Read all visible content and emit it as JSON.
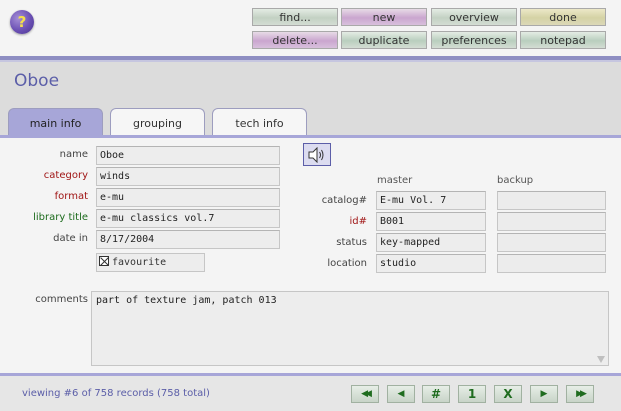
{
  "toolbar": {
    "help": "?",
    "find": "find...",
    "new": "new",
    "overview": "overview",
    "done": "done",
    "delete": "delete...",
    "duplicate": "duplicate",
    "preferences": "preferences",
    "notepad": "notepad"
  },
  "record": {
    "title": "Oboe"
  },
  "tabs": [
    "main info",
    "grouping",
    "tech info"
  ],
  "form": {
    "name": {
      "label": "name",
      "value": "Oboe"
    },
    "category": {
      "label": "category",
      "value": "winds"
    },
    "format": {
      "label": "format",
      "value": "e-mu"
    },
    "library": {
      "label": "library title",
      "value": "e-mu classics vol.7"
    },
    "date": {
      "label": "date in",
      "value": "8/17/2004"
    },
    "favourite": {
      "label": "favourite",
      "checked": true
    }
  },
  "storage": {
    "master_header": "master",
    "backup_header": "backup",
    "catalog": {
      "label": "catalog#",
      "master": "E-mu Vol. 7",
      "backup": ""
    },
    "id": {
      "label": "id#",
      "master": "B001",
      "backup": ""
    },
    "status": {
      "label": "status",
      "master": "key-mapped",
      "backup": ""
    },
    "location": {
      "label": "location",
      "master": "studio",
      "backup": ""
    }
  },
  "comments": {
    "label": "comments",
    "value": "part of texture jam, patch 013"
  },
  "status_bar": {
    "text": "viewing #6 of 758 records (758 total)"
  },
  "nav": {
    "first": "◀◀",
    "prev": "◀",
    "goto": "#",
    "one": "1",
    "x": "X",
    "next": "▶",
    "last": "▶▶"
  },
  "colors": {
    "accent": "#a7a6d8",
    "title": "#5b5ea8",
    "required_label": "#a01616",
    "library_label": "#1d6b1d"
  }
}
